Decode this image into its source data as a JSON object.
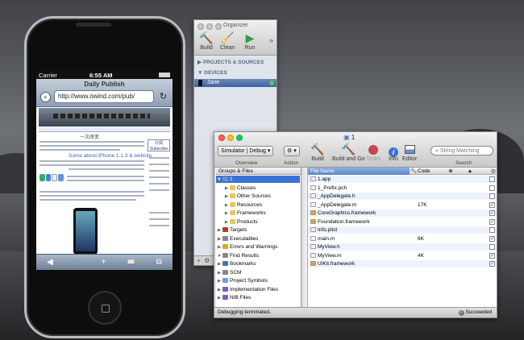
{
  "colors": {
    "selection": "#3b73d4",
    "ios_toolbar": "#8e9fb3",
    "xcode_chrome": "#d0d0d0"
  },
  "iphone": {
    "status": {
      "carrier": "Carrier",
      "time": "6:55 AM"
    },
    "navbar": {
      "title": "Daily Publish",
      "url": "http://www.owind.com/pub/"
    },
    "page": {
      "heading": "一次改变",
      "article_title": "Some about iPhone 1.1.3 & webclip",
      "sidebox": "订阅 Subscribe"
    },
    "toolbar": [
      "◀",
      "▶",
      "+",
      "📖",
      "⧉"
    ]
  },
  "organizer": {
    "title": "Organizer",
    "toolbar": [
      "Build",
      "Clean",
      "Run"
    ],
    "sections": {
      "projects": "PROJECTS & SOURCES",
      "devices": "DEVICES"
    },
    "device": "Jane"
  },
  "xcode": {
    "title": "1",
    "config": "Simulator | Debug",
    "toolbar": {
      "build": "Build",
      "build_and_go": "Build and Go",
      "tasks": "Tasks",
      "info": "Info",
      "editor": "Editor",
      "search_placeholder": "String Matching"
    },
    "sections": {
      "overview": "Overview",
      "action": "Action",
      "search": "Search"
    },
    "groups_header": "Groups & Files",
    "groups": [
      {
        "label": "1",
        "indent": 0,
        "selected": true,
        "open": true,
        "icon_color": "#6d8fc9"
      },
      {
        "label": "Classes",
        "indent": 1,
        "icon_color": "#e8c65a"
      },
      {
        "label": "Other Sources",
        "indent": 1,
        "icon_color": "#e8c65a"
      },
      {
        "label": "Resources",
        "indent": 1,
        "icon_color": "#e8c65a"
      },
      {
        "label": "Frameworks",
        "indent": 1,
        "icon_color": "#e8c65a"
      },
      {
        "label": "Products",
        "indent": 1,
        "icon_color": "#e8c65a"
      },
      {
        "label": "Targets",
        "indent": 0,
        "icon_color": "#c0392b"
      },
      {
        "label": "Executables",
        "indent": 0,
        "icon_color": "#7d8a99"
      },
      {
        "label": "Errors and Warnings",
        "indent": 0,
        "icon_color": "#e6a51a"
      },
      {
        "label": "Find Results",
        "indent": 0,
        "open": true,
        "icon_color": "#888888"
      },
      {
        "label": "Bookmarks",
        "indent": 0,
        "icon_color": "#4b6fb5"
      },
      {
        "label": "SCM",
        "indent": 0,
        "icon_color": "#888888"
      },
      {
        "label": "Project Symbols",
        "indent": 0,
        "icon_color": "#6aa0d8"
      },
      {
        "label": "Implementation Files",
        "indent": 0,
        "icon_color": "#7a5dbb"
      },
      {
        "label": "NIB Files",
        "indent": 0,
        "icon_color": "#7a5dbb"
      }
    ],
    "file_columns": [
      "File Name",
      "Code"
    ],
    "files": [
      {
        "name": "1.app",
        "code": "",
        "checked": false
      },
      {
        "name": "1_Prefix.pch",
        "code": "",
        "checked": false
      },
      {
        "name": "_AppDelegate.h",
        "code": "",
        "checked": false
      },
      {
        "name": "_AppDelegate.m",
        "code": "17K",
        "checked": true
      },
      {
        "name": "CoreGraphics.framework",
        "code": "",
        "checked": true
      },
      {
        "name": "Foundation.framework",
        "code": "",
        "checked": true
      },
      {
        "name": "Info.plist",
        "code": "",
        "checked": false
      },
      {
        "name": "main.m",
        "code": "6K",
        "checked": true
      },
      {
        "name": "MyView.h",
        "code": "",
        "checked": false
      },
      {
        "name": "MyView.m",
        "code": "4K",
        "checked": true
      },
      {
        "name": "UIKit.framework",
        "code": "",
        "checked": true
      }
    ],
    "status_left": "Debugging terminated.",
    "status_right": "Succeeded"
  }
}
